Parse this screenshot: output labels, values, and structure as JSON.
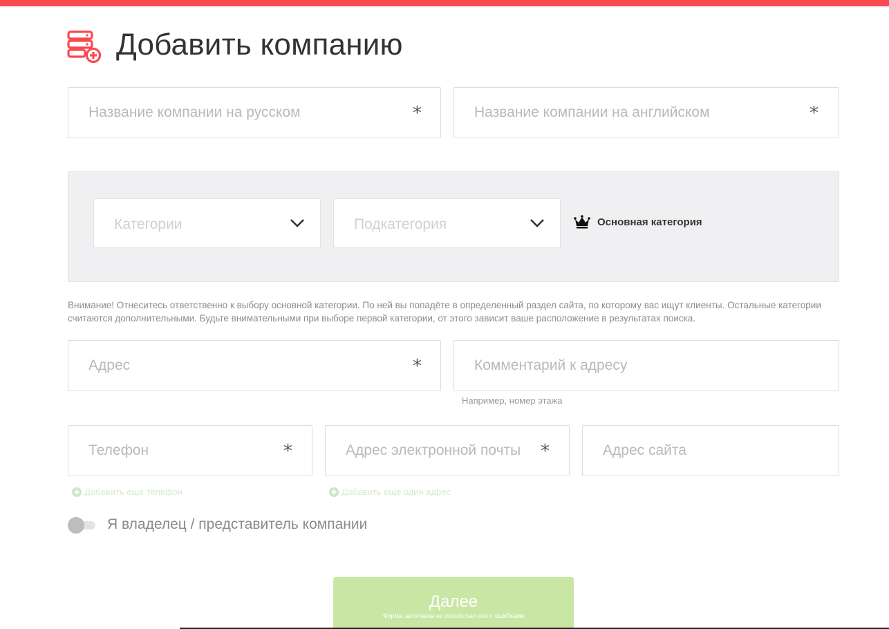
{
  "header": {
    "accent_color": "#f94a52",
    "title": "Добавить компанию",
    "icon": "server-add-icon"
  },
  "company": {
    "name_ru_placeholder": "Название компании на русском",
    "name_en_placeholder": "Название компании на английском",
    "required_mark": "*"
  },
  "categories": {
    "category_placeholder": "Категории",
    "subcategory_placeholder": "Подкатегория",
    "main_category_label": "Основная категория",
    "main_category_icon": "crown-icon",
    "notice": "Внимание! Отнеситесь ответственно к выбору основной категории. По ней вы попадёте в определенный раздел сайта, по которому вас ищут клиенты. Остальные категории считаются дополнительными. Будьте внимательными при выборе первой категории, от этого зависит ваше расположение в результатах поиска."
  },
  "address": {
    "address_placeholder": "Адрес",
    "comment_placeholder": "Комментарий к адресу",
    "comment_hint": "Например, номер этажа"
  },
  "contacts": {
    "phone_placeholder": "Телефон",
    "email_placeholder": "Адрес электронной почты",
    "site_placeholder": "Адрес сайта",
    "add_phone": "Добавить еще телефон",
    "add_email": "Добавить еще один адрес"
  },
  "owner_toggle": {
    "label": "Я владелец / представитель компании",
    "checked": false
  },
  "submit": {
    "label": "Далее",
    "sublabel": "Форма заполнена не полностью или с ошибками",
    "color": "#c9e6a5"
  }
}
